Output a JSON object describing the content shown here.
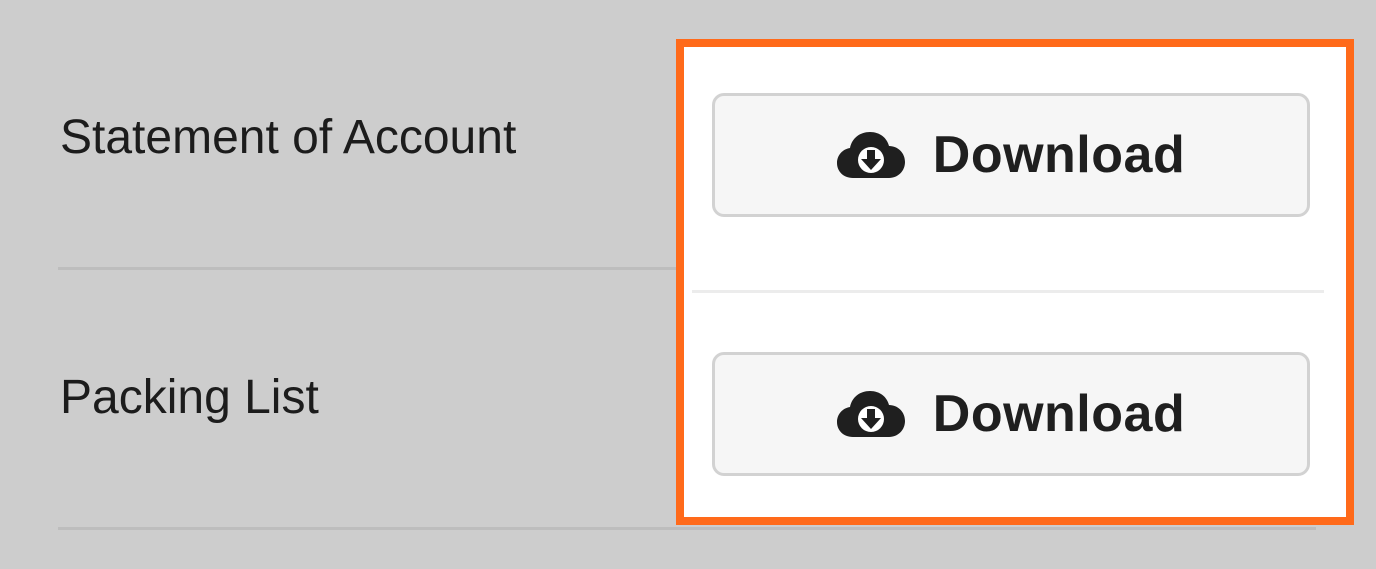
{
  "documents": [
    {
      "label": "Statement of Account",
      "action_label": "Download",
      "action_icon": "cloud-download-icon"
    },
    {
      "label": "Packing List",
      "action_label": "Download",
      "action_icon": "cloud-download-icon"
    }
  ],
  "colors": {
    "background": "#cdcdcd",
    "highlight_border": "#ff6a1a",
    "button_bg": "#f6f6f6",
    "button_border": "#d2d2d2",
    "text": "#1c1c1c"
  }
}
